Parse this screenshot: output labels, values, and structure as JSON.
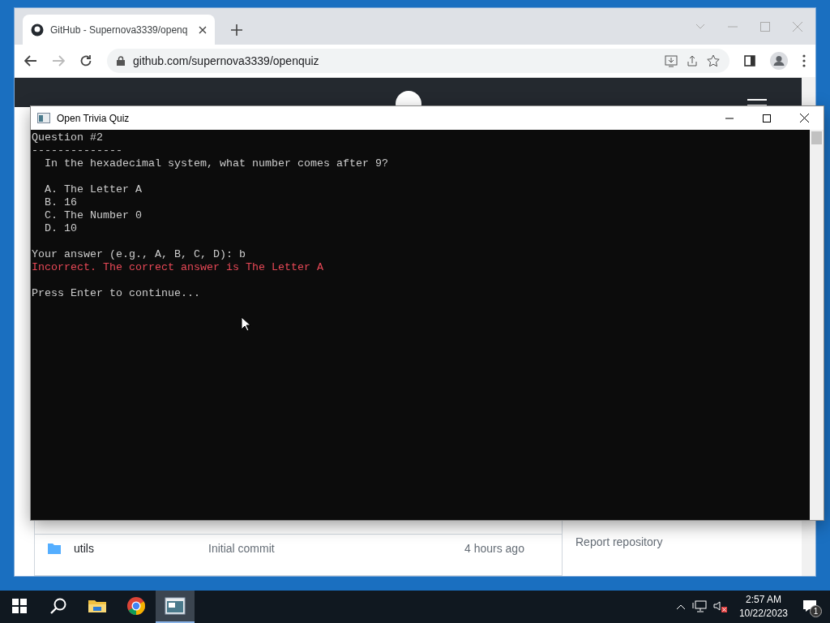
{
  "browser": {
    "tabs": [
      {
        "title": "GitHub - Supernova3339/openq",
        "selected": true
      }
    ],
    "url": "github.com/supernova3339/openquiz",
    "files": [
      {
        "name": "utils",
        "message": "Initial commit",
        "age": "4 hours ago"
      }
    ],
    "sidebar_link": "Report repository"
  },
  "console": {
    "title": "Open Trivia Quiz",
    "blocks": [
      {
        "lines": [
          {
            "text": "Question #2",
            "kind": "normal"
          },
          {
            "text": "--------------",
            "kind": "normal"
          },
          {
            "text": "  In the hexadecimal system, what number comes after 9?",
            "kind": "normal"
          }
        ]
      },
      {
        "lines": [
          {
            "text": "  A. The Letter A",
            "kind": "normal"
          },
          {
            "text": "  B. 16",
            "kind": "normal"
          },
          {
            "text": "  C. The Number 0",
            "kind": "normal"
          },
          {
            "text": "  D. 10",
            "kind": "normal"
          }
        ]
      },
      {
        "lines": [
          {
            "text": "Your answer (e.g., A, B, C, D): b",
            "kind": "normal"
          },
          {
            "text": "Incorrect. The correct answer is The Letter A",
            "kind": "error"
          }
        ]
      },
      {
        "lines": [
          {
            "text": "Press Enter to continue...",
            "kind": "normal"
          }
        ]
      }
    ]
  },
  "taskbar": {
    "apps": [
      {
        "kind": "explorer",
        "selected": false
      },
      {
        "kind": "chrome",
        "selected": false
      },
      {
        "kind": "console",
        "selected": true
      }
    ],
    "time": "2:57 AM",
    "date": "10/22/2023",
    "notifications": "1"
  }
}
